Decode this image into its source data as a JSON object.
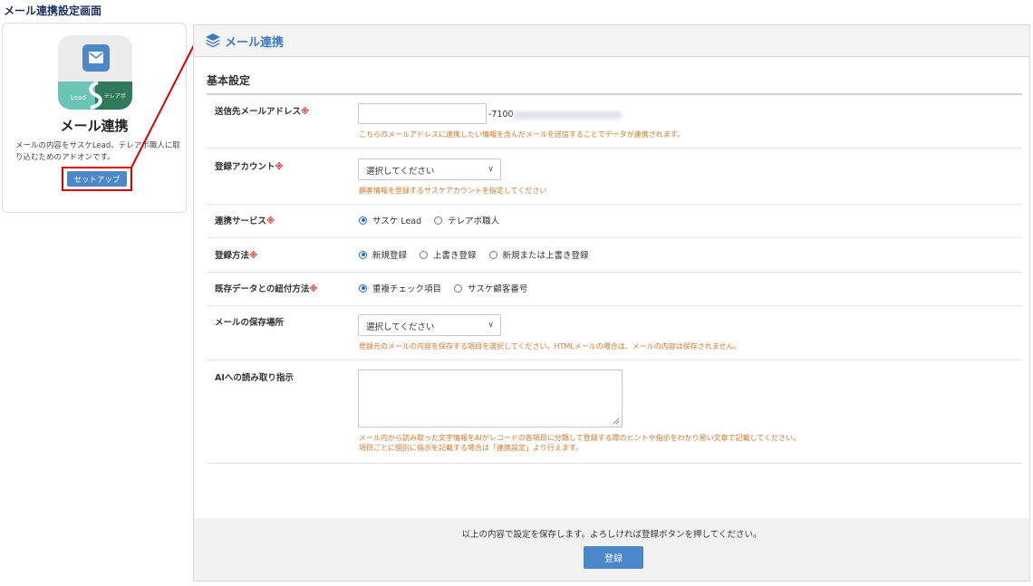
{
  "page_heading": "メール連携設定画面",
  "addon": {
    "icon_name": "mail-icon",
    "icon_label_left": "Lead",
    "icon_label_right": "テレアポ",
    "title": "メール連携",
    "description": "メールの内容をサスケLead、テレアポ職人に取り込むためのアドオンです。",
    "setup_label": "セットアップ"
  },
  "panel": {
    "icon_name": "layers-icon",
    "title": "メール連携",
    "section_title": "基本設定",
    "fields": {
      "email": {
        "label": "送信先メールアドレス",
        "required_mark": "※",
        "value": "",
        "suffix": "-7100",
        "hint": "こちらのメールアドレスに連携したい情報を含んだメールを送信することでデータが連携されます。"
      },
      "account": {
        "label": "登録アカウント",
        "required_mark": "※",
        "selected": "選択してください",
        "hint": "顧客情報を登録するサスケアカウントを指定してください"
      },
      "service": {
        "label": "連携サービス",
        "required_mark": "※",
        "options": [
          "サスケ Lead",
          "テレアポ職人"
        ],
        "selected_index": 0
      },
      "method": {
        "label": "登録方法",
        "required_mark": "※",
        "options": [
          "新規登録",
          "上書き登録",
          "新規または上書き登録"
        ],
        "selected_index": 0
      },
      "link": {
        "label": "既存データとの紐付方法",
        "required_mark": "※",
        "options": [
          "重複チェック項目",
          "サスケ顧客番号"
        ],
        "selected_index": 0
      },
      "storage": {
        "label": "メールの保存場所",
        "selected": "選択してください",
        "hint": "登録元のメールの内容を保存する項目を選択してください。HTMLメールの場合は、メールの内容は保存されません。"
      },
      "ai": {
        "label": "AIへの読み取り指示",
        "value": "",
        "hint_line1": "メール内から読み取った文字情報をAIがレコードの各項目に分類して登録する際のヒントや指示をわかり易い文章で記載してください。",
        "hint_line2": "項目ごとに個別に指示を記載する場合は「連携設定」より行えます。"
      }
    },
    "footer_note": "以上の内容で設定を保存します。よろしければ登録ボタンを押してください。",
    "submit_label": "登録"
  },
  "colors": {
    "accent": "#4b88c9",
    "required": "#e0322e",
    "hint": "#d4762a",
    "highlight": "#e00000"
  }
}
